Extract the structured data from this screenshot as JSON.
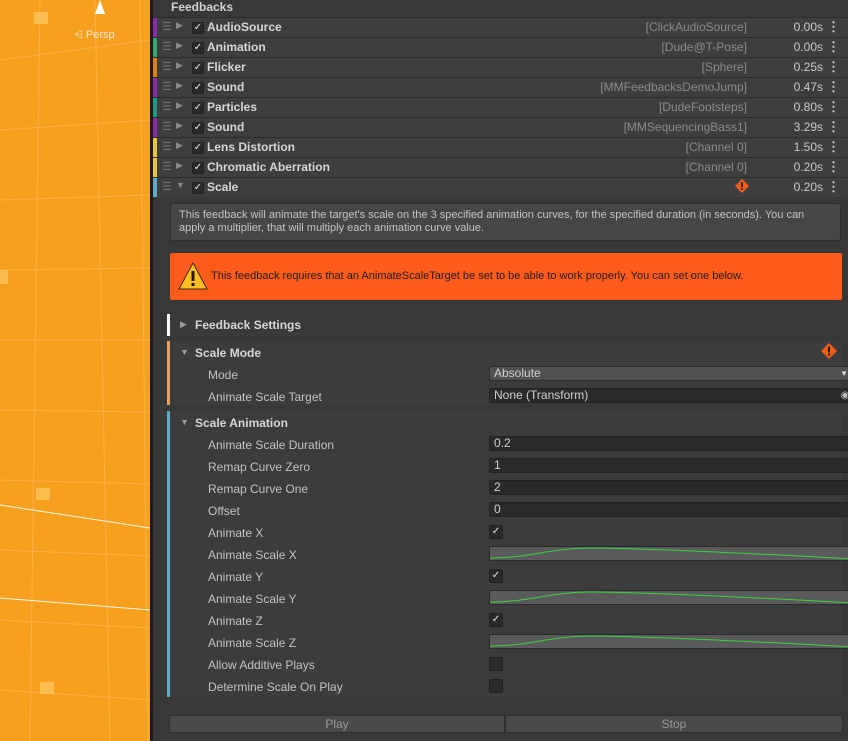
{
  "scene": {
    "view_label": "Persp"
  },
  "inspector": {
    "title": "Feedbacks",
    "feedbacks": [
      {
        "name": "AudioSource",
        "target": "[ClickAudioSource]",
        "duration": "0.00s",
        "color": "#8a2aa8",
        "expanded": false
      },
      {
        "name": "Animation",
        "target": "[Dude@T-Pose]",
        "duration": "0.00s",
        "color": "#2fa86a",
        "expanded": false
      },
      {
        "name": "Flicker",
        "target": "[Sphere]",
        "duration": "0.25s",
        "color": "#e0820f",
        "expanded": false
      },
      {
        "name": "Sound",
        "target": "[MMFeedbacksDemoJump]",
        "duration": "0.47s",
        "color": "#8a2aa8",
        "expanded": false
      },
      {
        "name": "Particles",
        "target": "[DudeFootsteps]",
        "duration": "0.80s",
        "color": "#1f9a85",
        "expanded": false
      },
      {
        "name": "Sound",
        "target": "[MMSequencingBass1]",
        "duration": "3.29s",
        "color": "#8a2aa8",
        "expanded": false
      },
      {
        "name": "Lens Distortion",
        "target": "[Channel 0]",
        "duration": "1.50s",
        "color": "#e6c83a",
        "expanded": false
      },
      {
        "name": "Chromatic Aberration",
        "target": "[Channel 0]",
        "duration": "0.20s",
        "color": "#e6c83a",
        "expanded": false
      },
      {
        "name": "Scale",
        "target": "",
        "duration": "0.20s",
        "color": "#5fa8c8",
        "expanded": true
      }
    ],
    "help_text": "This feedback will animate the target's scale on the 3 specified animation curves, for the specified duration (in seconds). You can apply a multiplier, that will multiply each animation curve value.",
    "warning_text": "This feedback requires that an AnimateScaleTarget be set to be able to work properly. You can set one below.",
    "sections": {
      "settings": {
        "title": "Feedback Settings"
      },
      "mode": {
        "title": "Scale Mode",
        "mode_label": "Mode",
        "mode_value": "Absolute",
        "target_label": "Animate Scale Target",
        "target_value": "None (Transform)"
      },
      "animation": {
        "title": "Scale Animation",
        "duration_label": "Animate Scale Duration",
        "duration_value": "0.2",
        "remap_zero_label": "Remap Curve Zero",
        "remap_zero_value": "1",
        "remap_one_label": "Remap Curve One",
        "remap_one_value": "2",
        "offset_label": "Offset",
        "offset_value": "0",
        "animate_x_label": "Animate X",
        "animate_x": true,
        "curve_x_label": "Animate Scale X",
        "animate_y_label": "Animate Y",
        "animate_y": true,
        "curve_y_label": "Animate Scale Y",
        "animate_z_label": "Animate Z",
        "animate_z": true,
        "curve_z_label": "Animate Scale Z",
        "additive_label": "Allow Additive Plays",
        "additive": false,
        "determine_label": "Determine Scale On Play",
        "determine": false
      }
    },
    "buttons": {
      "play": "Play",
      "stop": "Stop"
    },
    "colors": {
      "warning": "#ff5b1a",
      "curve": "#3ad43a",
      "scale_mode_bar": "#e8a060",
      "scale_anim_bar": "#5fa8c8"
    }
  }
}
